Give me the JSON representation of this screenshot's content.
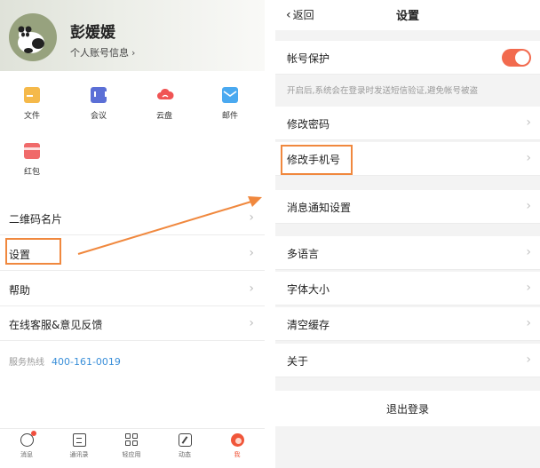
{
  "left": {
    "profile": {
      "name": "彭媛媛",
      "account_info": "个人账号信息",
      "chevron": "›"
    },
    "apps": [
      {
        "label": "文件",
        "icon": "folder-icon"
      },
      {
        "label": "会议",
        "icon": "meeting-icon"
      },
      {
        "label": "云盘",
        "icon": "cloud-icon"
      },
      {
        "label": "邮件",
        "icon": "mail-icon"
      },
      {
        "label": "红包",
        "icon": "red-envelope-icon"
      }
    ],
    "menu": [
      {
        "label": "二维码名片"
      },
      {
        "label": "设置"
      },
      {
        "label": "帮助"
      },
      {
        "label": "在线客服&意见反馈"
      }
    ],
    "hotline": {
      "label": "服务热线",
      "number": "400-161-0019"
    },
    "tabs": [
      {
        "label": "消息",
        "icon": "message-icon"
      },
      {
        "label": "通讯录",
        "icon": "contacts-icon"
      },
      {
        "label": "轻应用",
        "icon": "apps-grid-icon"
      },
      {
        "label": "动态",
        "icon": "dynamic-icon"
      },
      {
        "label": "我",
        "icon": "me-icon",
        "active": true
      }
    ]
  },
  "right": {
    "nav": {
      "back_label": "返回",
      "back_icon": "‹",
      "title": "设置"
    },
    "account_protection": {
      "label": "帐号保护",
      "enabled": true
    },
    "hint": "开启后,系统会在登录时发送短信验证,避免帐号被盗",
    "rows": [
      {
        "label": "修改密码"
      },
      {
        "label": "修改手机号"
      },
      {
        "label": "消息通知设置"
      },
      {
        "label": "多语言"
      },
      {
        "label": "字体大小"
      },
      {
        "label": "清空缓存"
      },
      {
        "label": "关于"
      }
    ],
    "logout": "退出登录"
  },
  "colors": {
    "accent": "#f26a4e",
    "highlight": "#f0883e",
    "link": "#3a8fd9"
  },
  "arrow_glyph": "›"
}
